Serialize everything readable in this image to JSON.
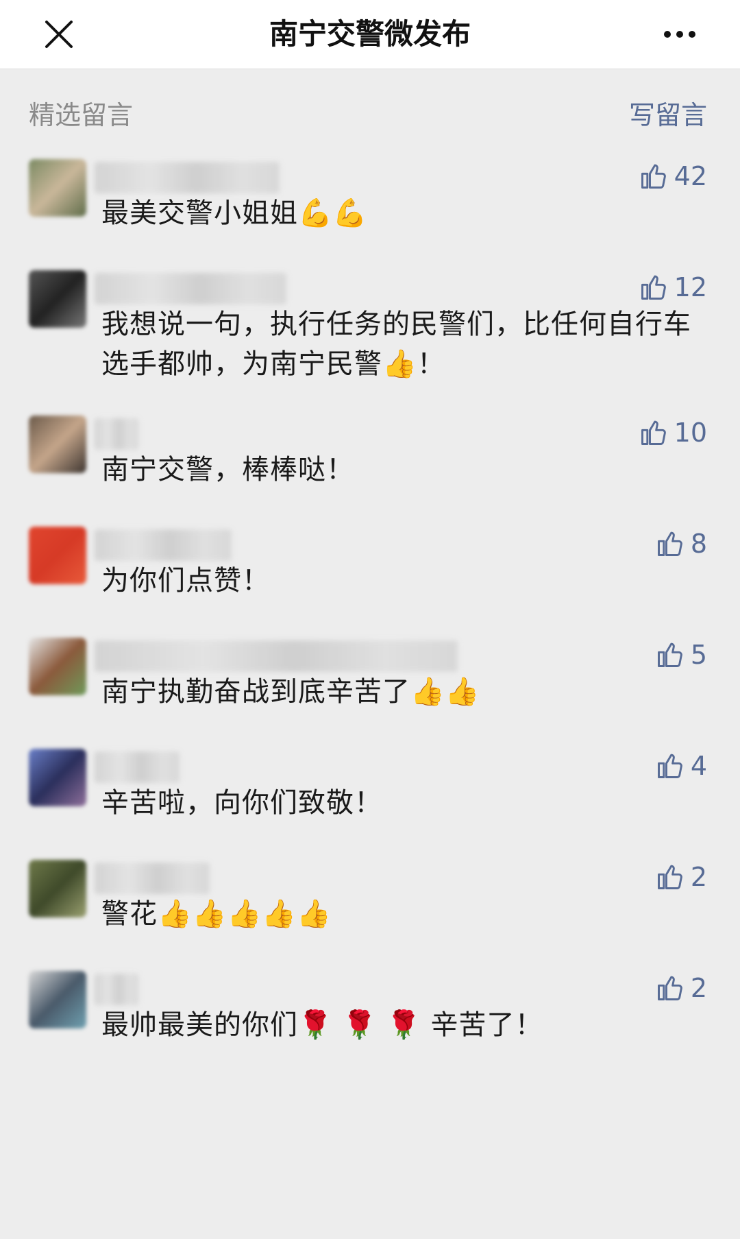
{
  "header": {
    "title": "南宁交警微发布",
    "close_icon": "close-icon",
    "more_icon": "more-icon"
  },
  "section": {
    "title": "精选留言",
    "write_label": "写留言"
  },
  "colors": {
    "background": "#ededed",
    "link": "#576b95",
    "header_bg": "#ffffff"
  },
  "comments": [
    {
      "text": "最美交警小姐姐💪💪",
      "likes": "42"
    },
    {
      "text": "我想说一句，执行任务的民警们，比任何自行车选手都帅，为南宁民警👍！",
      "likes": "12"
    },
    {
      "text": "南宁交警，棒棒哒！",
      "likes": "10"
    },
    {
      "text": "为你们点赞！",
      "likes": "8"
    },
    {
      "text": "南宁执勤奋战到底辛苦了👍👍",
      "likes": "5"
    },
    {
      "text": "辛苦啦，向你们致敬！",
      "likes": "4"
    },
    {
      "text": "警花👍👍👍👍👍",
      "likes": "2"
    },
    {
      "text": "最帅最美的你们🌹 🌹 🌹 辛苦了！",
      "likes": "2"
    }
  ]
}
